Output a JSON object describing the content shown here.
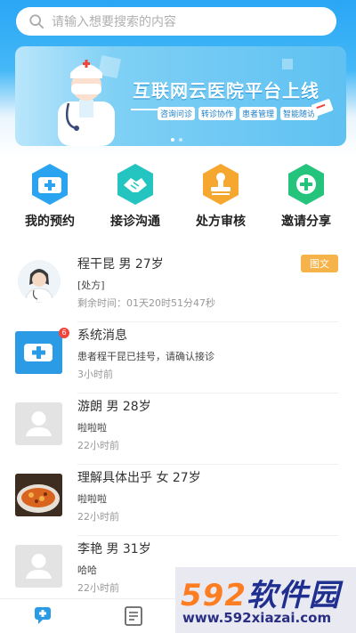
{
  "search": {
    "placeholder": "请输入想要搜索的内容",
    "icon": "search-icon"
  },
  "banner": {
    "title": "互联网云医院平台上线",
    "tags": [
      "咨询问诊",
      "转诊协作",
      "患者管理",
      "智能随访"
    ],
    "page_count": 2,
    "active_page": 1
  },
  "quick_actions": [
    {
      "label": "我的预约",
      "icon": "hospital-plus-icon",
      "color": "#2aa4f0"
    },
    {
      "label": "接诊沟通",
      "icon": "handshake-icon",
      "color": "#24c4c0"
    },
    {
      "label": "处方审核",
      "icon": "stamp-icon",
      "color": "#f6a72f"
    },
    {
      "label": "邀请分享",
      "icon": "plus-circle-icon",
      "color": "#25c47c"
    }
  ],
  "messages": [
    {
      "name": "程干昆 男 27岁",
      "line2": "[处方]",
      "line3": "剩余时间：01天20时51分47秒",
      "tag": "图文",
      "avatar": "doctor-avatar"
    },
    {
      "name": "系统消息",
      "line2": "患者程干昆已挂号，请确认接诊",
      "line3": "3小时前",
      "badge": "6",
      "avatar": "system-message-icon"
    },
    {
      "name": "游朗 男 28岁",
      "line2": "啦啦啦",
      "line3": "22小时前",
      "avatar": "default-user-avatar"
    },
    {
      "name": "理解具体出乎 女 27岁",
      "line2": "啦啦啦",
      "line3": "22小时前",
      "avatar": "food-photo-avatar"
    },
    {
      "name": "李艳 男 31岁",
      "line2": "哈哈",
      "line3": "22小时前",
      "avatar": "default-user-avatar"
    }
  ],
  "tabbar": {
    "tabs": [
      {
        "icon": "chat-plus-icon"
      },
      {
        "icon": "document-icon"
      }
    ]
  },
  "watermark": {
    "brand_num": "592",
    "brand_text": "软件园",
    "url": "www.592xiazai.com"
  },
  "colors": {
    "primary": "#2aa6f5",
    "tag": "#f6b34a",
    "badge": "#f0443c"
  }
}
